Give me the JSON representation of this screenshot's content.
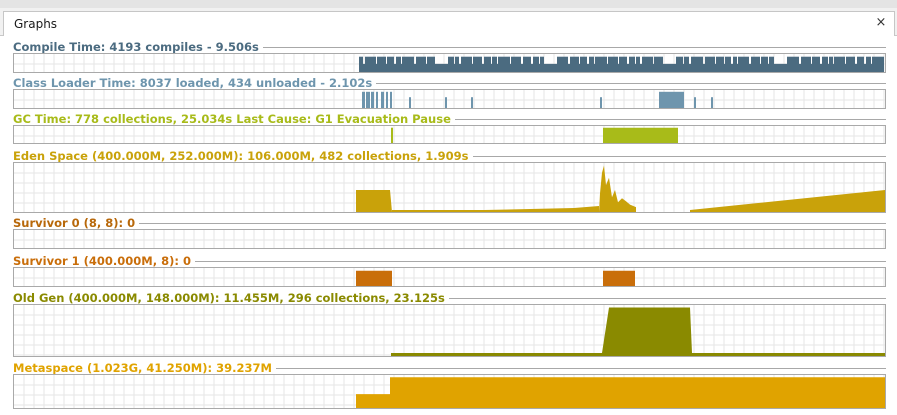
{
  "window": {
    "tab_title": "Graphs",
    "close_glyph": "×"
  },
  "graphs": [
    {
      "key": "compile",
      "title": "Compile Time: 4193 compiles - 9.506s",
      "color": "#4b6b80"
    },
    {
      "key": "classloader",
      "title": "Class Loader Time: 8037 loaded, 434 unloaded - 2.102s",
      "color": "#6e95ad"
    },
    {
      "key": "gc",
      "title": "GC Time: 778 collections, 25.034s  Last Cause: G1 Evacuation Pause",
      "color": "#a8bb19"
    },
    {
      "key": "eden",
      "title": "Eden Space (400.000M, 252.000M): 106.000M, 482 collections, 1.909s",
      "color": "#c9a20a"
    },
    {
      "key": "survivor0",
      "title": "Survivor 0 (8, 8): 0",
      "color": "#b8680a"
    },
    {
      "key": "survivor1",
      "title": "Survivor 1 (400.000M, 8): 0",
      "color": "#c96e0a"
    },
    {
      "key": "oldgen",
      "title": "Old Gen (400.000M, 148.000M): 11.455M, 296 collections, 23.125s",
      "color": "#8a8a00"
    },
    {
      "key": "metaspace",
      "title": "Metaspace (1.023G, 41.250M): 39.237M",
      "color": "#e0a300"
    }
  ]
}
